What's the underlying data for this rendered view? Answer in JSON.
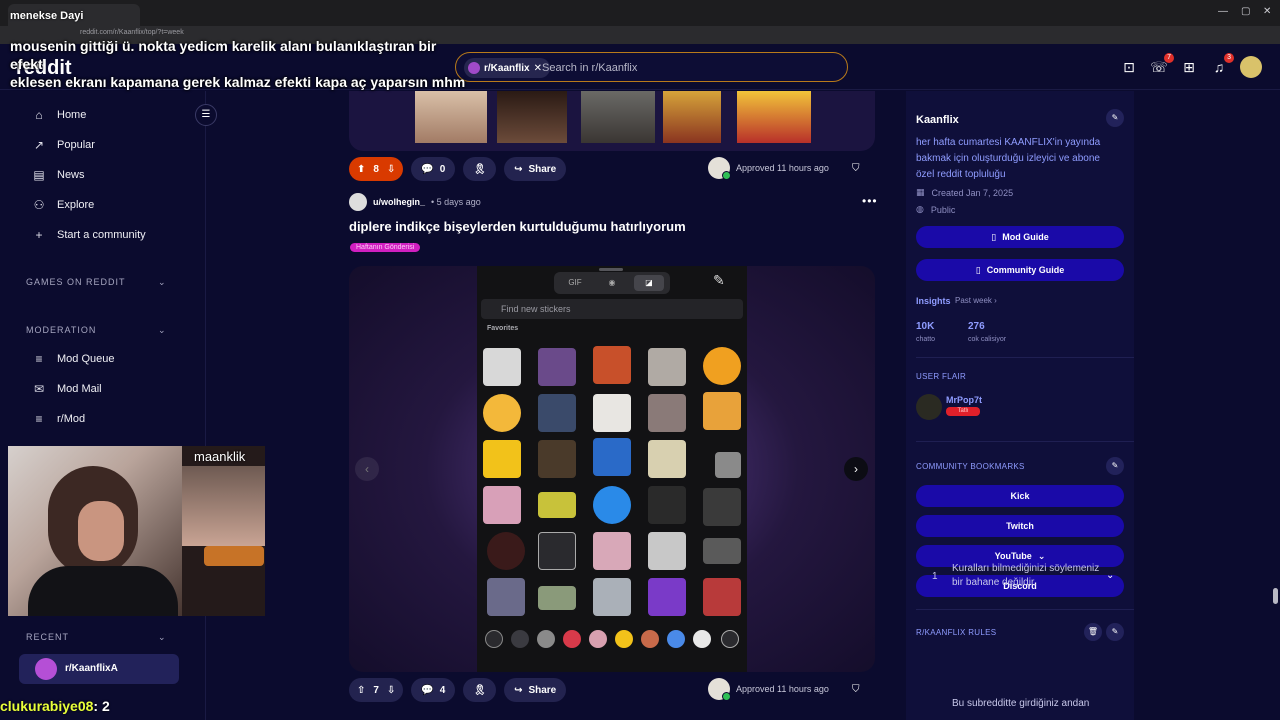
{
  "browser": {
    "streamer_name": "menekse Dayi",
    "url": "reddit.com/r/Kaanflix/top/?t=week"
  },
  "overlay": {
    "line1": "mousenin gittiği ü. nokta yedicm karelik alanı bulanıklaştıran bir efekt",
    "line2": "eklesen ekranı kapamana gerek kalmaz efekti kapa aç yaparsın mhm",
    "chat_user": "clukurabiye08",
    "chat_count": ": 2"
  },
  "header": {
    "logo": "reddit",
    "search_chip": "r/Kaanflix",
    "search_placeholder": "Search in r/Kaanflix",
    "chat_badge": "7",
    "notif_badge": "3"
  },
  "sidebar": {
    "items": [
      {
        "label": "Home",
        "icon": "home-icon"
      },
      {
        "label": "Popular",
        "icon": "popular-icon"
      },
      {
        "label": "News",
        "icon": "news-icon"
      },
      {
        "label": "Explore",
        "icon": "explore-icon"
      },
      {
        "label": "Start a community",
        "icon": "plus-icon"
      }
    ],
    "games_title": "GAMES ON REDDIT",
    "moderation_title": "MODERATION",
    "mod_items": [
      {
        "label": "Mod Queue",
        "icon": "mod-queue-icon"
      },
      {
        "label": "Mod Mail",
        "icon": "mod-mail-icon"
      },
      {
        "label": "r/Mod",
        "icon": "r-mod-icon"
      }
    ],
    "recent_title": "RECENT",
    "recent_item": "r/KaanflixA"
  },
  "webcam": {
    "label": "maanklik"
  },
  "post1": {
    "upvotes": "8",
    "comments": "0",
    "share": "Share",
    "approved": "Approved 11 hours ago"
  },
  "post2": {
    "user": "u/wolhegin_",
    "time": "• 5 days ago",
    "title": "diplere indikçe bişeylerden kurtulduğumu hatırlıyorum",
    "flair": "Haftanın Gönderisi",
    "upvotes": "7",
    "comments": "4",
    "share": "Share",
    "approved": "Approved 11 hours ago",
    "sticker_search": "Find new stickers",
    "favorites_label": "Favorites"
  },
  "rsidebar": {
    "name": "Kaanflix",
    "description": "her hafta cumartesi KAANFLIX'in yayında bakmak için oluşturduğu izleyici ve abone özel reddit topluluğu",
    "created": "Created Jan 7, 2025",
    "visibility": "Public",
    "mod_guide": "Mod Guide",
    "community_guide": "Community Guide",
    "insights": "Insights",
    "insights_period": "Past week",
    "stat1_value": "10K",
    "stat1_label": "chatto",
    "stat2_value": "276",
    "stat2_label": "cok calisiyor",
    "user_flair_title": "USER FLAIR",
    "flair_user": "MrPop7t",
    "flair_badge": "Tatlı",
    "bookmarks_title": "COMMUNITY BOOKMARKS",
    "bookmarks": [
      "Kick",
      "Twitch",
      "YouTube",
      "Discord"
    ],
    "rules_title": "R/KAANFLIX RULES",
    "rule1_num": "1",
    "rule1_text": "Kuralları bilmediğinizi söylemeniz bir bahane değildir.",
    "rule2_text": "Bu subredditte girdiğiniz andan"
  },
  "colors": {
    "background": "#0b0b2e",
    "accent_button": "#1a0aa8",
    "upvote_active": "#d93a00",
    "flair_pink": "#d01fc0"
  }
}
